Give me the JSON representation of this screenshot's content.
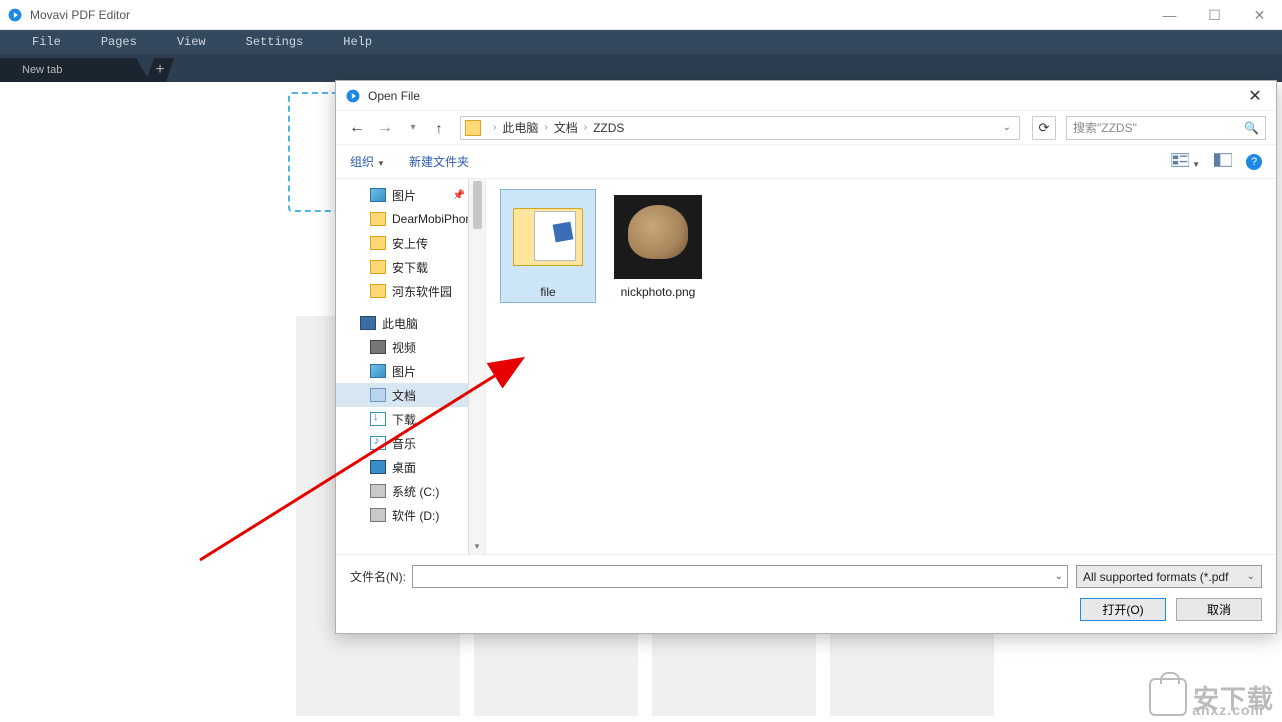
{
  "app": {
    "title": "Movavi PDF Editor",
    "menus": [
      "File",
      "Pages",
      "View",
      "Settings",
      "Help"
    ],
    "tab_label": "New tab"
  },
  "dialog": {
    "title": "Open File",
    "breadcrumb": {
      "root": "此电脑",
      "mid": "文档",
      "leaf": "ZZDS"
    },
    "search_placeholder": "搜索\"ZZDS\"",
    "toolbar": {
      "organize": "组织",
      "new_folder": "新建文件夹"
    },
    "tree": {
      "pictures": "图片",
      "dearmobi": "DearMobiPhon",
      "anupload": "安上传",
      "andownload": "安下载",
      "hedong": "河东软件园",
      "this_pc": "此电脑",
      "video": "视频",
      "pictures2": "图片",
      "documents": "文档",
      "downloads": "下载",
      "music": "音乐",
      "desktop": "桌面",
      "drive_c": "系统 (C:)",
      "drive_d": "软件 (D:)"
    },
    "files": {
      "folder_name": "file",
      "image_name": "nickphoto.png"
    },
    "footer": {
      "filename_label": "文件名(N):",
      "filter": "All supported formats (*.pdf",
      "open": "打开(O)",
      "cancel": "取消"
    }
  },
  "watermark": {
    "text": "安下载",
    "url": "anxz.com"
  }
}
